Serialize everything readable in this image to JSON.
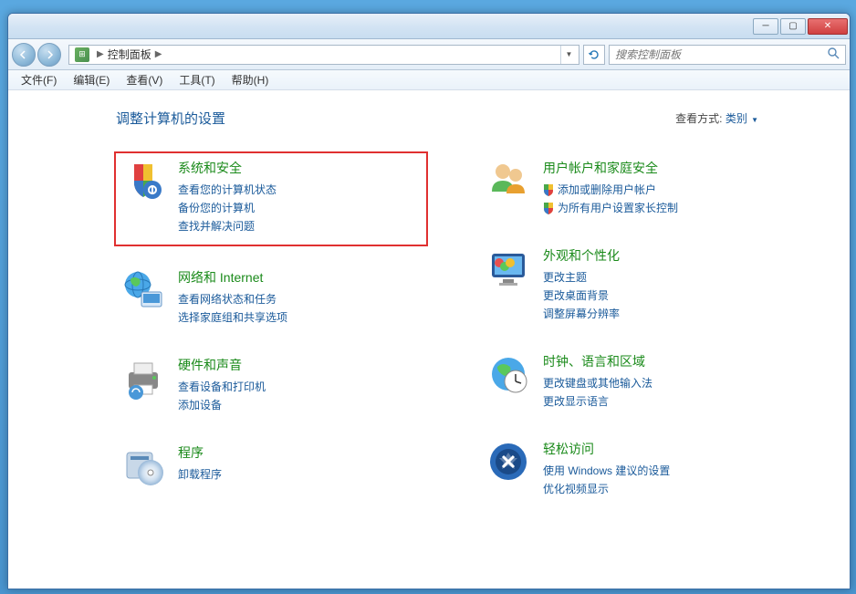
{
  "breadcrumb": {
    "root": "控制面板"
  },
  "search": {
    "placeholder": "搜索控制面板"
  },
  "menubar": [
    "文件(F)",
    "编辑(E)",
    "查看(V)",
    "工具(T)",
    "帮助(H)"
  ],
  "header": {
    "title": "调整计算机的设置",
    "view_label": "查看方式:",
    "view_value": "类别"
  },
  "categories_left": [
    {
      "id": "system-security",
      "title": "系统和安全",
      "links": [
        "查看您的计算机状态",
        "备份您的计算机",
        "查找并解决问题"
      ],
      "highlighted": true,
      "icon": "shield"
    },
    {
      "id": "network-internet",
      "title": "网络和 Internet",
      "links": [
        "查看网络状态和任务",
        "选择家庭组和共享选项"
      ],
      "icon": "globe"
    },
    {
      "id": "hardware-sound",
      "title": "硬件和声音",
      "links": [
        "查看设备和打印机",
        "添加设备"
      ],
      "icon": "printer"
    },
    {
      "id": "programs",
      "title": "程序",
      "links": [
        "卸载程序"
      ],
      "icon": "disc"
    }
  ],
  "categories_right": [
    {
      "id": "user-accounts",
      "title": "用户帐户和家庭安全",
      "links": [
        {
          "text": "添加或删除用户帐户",
          "shield": true
        },
        {
          "text": "为所有用户设置家长控制",
          "shield": true
        }
      ],
      "icon": "users"
    },
    {
      "id": "appearance",
      "title": "外观和个性化",
      "links": [
        "更改主题",
        "更改桌面背景",
        "调整屏幕分辨率"
      ],
      "icon": "monitor"
    },
    {
      "id": "clock-region",
      "title": "时钟、语言和区域",
      "links": [
        "更改键盘或其他输入法",
        "更改显示语言"
      ],
      "icon": "clock"
    },
    {
      "id": "ease-access",
      "title": "轻松访问",
      "links": [
        "使用 Windows 建议的设置",
        "优化视频显示"
      ],
      "icon": "ease"
    }
  ]
}
